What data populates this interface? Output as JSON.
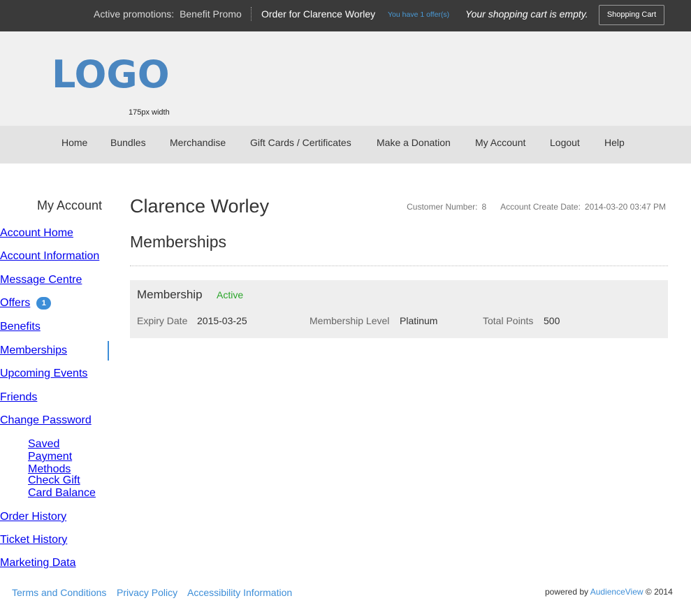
{
  "topbar": {
    "promotions_label": "Active promotions:",
    "promotion_name": "Benefit Promo",
    "order_label": "Order for Clarence Worley",
    "offers_link": "You have 1 offer(s)",
    "cart_message": "Your shopping cart is empty.",
    "cart_button": "Shopping Cart"
  },
  "header": {
    "logo": "LOGO",
    "logo_note": "175px width"
  },
  "nav": {
    "items": [
      "Home",
      "Bundles",
      "Merchandise",
      "Gift Cards / Certificates",
      "Make a Donation",
      "My Account",
      "Logout",
      "Help"
    ]
  },
  "sidebar": {
    "title": "My Account",
    "items": [
      {
        "label": "Account Home"
      },
      {
        "label": "Account Information"
      },
      {
        "label": "Message Centre"
      },
      {
        "label": "Offers",
        "badge": "1"
      },
      {
        "label": "Benefits"
      },
      {
        "label": "Memberships",
        "active": true
      },
      {
        "label": "Upcoming Events"
      },
      {
        "label": "Friends"
      },
      {
        "label": "Change Password"
      },
      {
        "label": "Saved Payment Methods"
      },
      {
        "label": "Check Gift Card Balance"
      },
      {
        "label": "Order History"
      },
      {
        "label": "Ticket History"
      },
      {
        "label": "Marketing Data"
      }
    ]
  },
  "main": {
    "customer_name": "Clarence Worley",
    "customer_number_label": "Customer Number:",
    "customer_number": "8",
    "create_date_label": "Account Create Date:",
    "create_date": "2014-03-20 03:47 PM",
    "section_title": "Memberships",
    "membership": {
      "title": "Membership",
      "status": "Active",
      "expiry_label": "Expiry Date",
      "expiry_value": "2015-03-25",
      "level_label": "Membership Level",
      "level_value": "Platinum",
      "points_label": "Total Points",
      "points_value": "500"
    }
  },
  "footer": {
    "links": [
      "Terms and Conditions",
      "Privacy Policy",
      "Accessibility Information"
    ],
    "powered_prefix": "powered by",
    "powered_brand": "AudienceView",
    "powered_suffix": "© 2014"
  },
  "colors": {
    "topbar_bg": "#3a3a3a",
    "header_bg": "#f0f0f0",
    "nav_bg": "#e3e3e3",
    "accent": "#3d8ed8",
    "logo": "#4a86c0",
    "status_active": "#2aa52a"
  }
}
